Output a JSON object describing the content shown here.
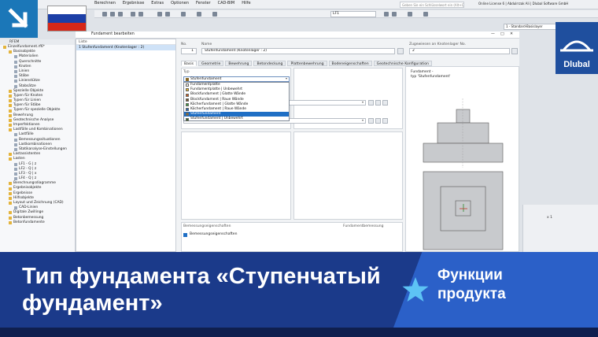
{
  "colors": {
    "accent": "#1b77b8",
    "banner": "#1b3a8a",
    "banner_accent": "#2b60c8",
    "selection": "#1f6fc5"
  },
  "app": {
    "menu": [
      "Berechnen",
      "Ergebnisse",
      "Extras",
      "Optionen",
      "Fenster",
      "CAD-BIM",
      "Hilfe"
    ],
    "search_placeholder": "Geben Sie ein Schlüsselwort ein (Alt+Q)",
    "license": "Online License 6 | Abdulrrzak Ali | Dlubal Software GmbH",
    "loadcase": "LF1",
    "design_combo": "1 - Standard-Basislayer"
  },
  "navigator": {
    "title": "RFEM",
    "items": [
      {
        "label": "Einzelfundament.rf6*",
        "level": 0
      },
      {
        "label": "Basisobjekte",
        "level": 1
      },
      {
        "label": "Materialien",
        "level": 2
      },
      {
        "label": "Querschnitte",
        "level": 2
      },
      {
        "label": "Knoten",
        "level": 2
      },
      {
        "label": "Linien",
        "level": 2
      },
      {
        "label": "Stäbe",
        "level": 2
      },
      {
        "label": "Linienstütze",
        "level": 2
      },
      {
        "label": "Stabsätze",
        "level": 2
      },
      {
        "label": "Spezielle Objekte",
        "level": 1
      },
      {
        "label": "Typen für Knoten",
        "level": 1
      },
      {
        "label": "Typen für Linien",
        "level": 1
      },
      {
        "label": "Typen für Stäbe",
        "level": 1
      },
      {
        "label": "Typen für spezielle Objekte",
        "level": 1
      },
      {
        "label": "Bewehrung",
        "level": 1
      },
      {
        "label": "Geotechnische Analyse",
        "level": 1
      },
      {
        "label": "Imperfektionen",
        "level": 1
      },
      {
        "label": "Lastfälle und Kombinationen",
        "level": 1
      },
      {
        "label": "Lastfälle",
        "level": 2
      },
      {
        "label": "Bemessungssituationen",
        "level": 2
      },
      {
        "label": "Lastkombinationen",
        "level": 2
      },
      {
        "label": "Statikanalyse-Einstellungen",
        "level": 2
      },
      {
        "label": "Lastassistenten",
        "level": 1
      },
      {
        "label": "Lasten",
        "level": 1
      },
      {
        "label": "LF1 - G | z",
        "level": 2
      },
      {
        "label": "LF2 - Q | z",
        "level": 2
      },
      {
        "label": "LF3 - Q | x",
        "level": 2
      },
      {
        "label": "LF4 - Q | z",
        "level": 2
      },
      {
        "label": "Berechnungsdiagramme",
        "level": 1
      },
      {
        "label": "Ergebnisobjekte",
        "level": 1
      },
      {
        "label": "Ergebnisse",
        "level": 1
      },
      {
        "label": "Hilfsobjekte",
        "level": 1
      },
      {
        "label": "Layout und Zeichnung (CAD)",
        "level": 1
      },
      {
        "label": "CAD-Linien",
        "level": 2
      },
      {
        "label": "Digitale Zwillinge",
        "level": 1
      },
      {
        "label": "Betonbemessung",
        "level": 1
      },
      {
        "label": "Betonfundamente",
        "level": 1
      }
    ]
  },
  "dialog": {
    "title": "Fundament bearbeiten",
    "list_header": "Liste",
    "list_item": "1  Stufenfundament (Knotenlager : 2)",
    "no_label": "No.",
    "no_value": "1",
    "name_label": "Name",
    "name_value": "Stufenfundament (Knotenlager : 2)",
    "assigned_label": "Zugewiesen an Knotenlager No.",
    "assigned_value": "2",
    "tabs": [
      "Basis",
      "Geometrie",
      "Bewehrung",
      "Betondeckung",
      "Plattenbewehrung",
      "Bodeneigenschaften",
      "Geotechnische Konfiguration"
    ],
    "typ_label": "Typ",
    "typ_selected": "Stufenfundament",
    "options": [
      {
        "label": "Fundamentplatte",
        "color": "#f2f2f2"
      },
      {
        "label": "Fundamentplatte | Unbewehrt",
        "color": "#e6b422"
      },
      {
        "label": "Blockfundament | Glatte Wände",
        "color": "#c85a1e"
      },
      {
        "label": "Blockfundament | Raue Wände",
        "color": "#7a5a2a"
      },
      {
        "label": "Köcherfundament | Glatte Wände",
        "color": "#3a9a3a"
      },
      {
        "label": "Köcherfundament | Raue Wände",
        "color": "#2a6ab5"
      },
      {
        "label": "Stufenfundament",
        "color": "#8a6a2a",
        "selected": true
      },
      {
        "label": "Stufenfundament | Unbewehrt",
        "color": "#3a6a2a"
      }
    ],
    "design_header": "Bemessungseigenschaften",
    "design_header_right": "Fundamentbemessung",
    "design_check": "Bemessungseigenschaften",
    "preview_line1": "Fundament -",
    "preview_line2": "typ 'Stufenfundament'"
  },
  "right_panel": {
    "value": "x 1"
  },
  "brand": "Dlubal",
  "banner": {
    "title": "Тип фундамента «Ступенчатый фундамент»",
    "subtitle": "Функции продукта"
  }
}
